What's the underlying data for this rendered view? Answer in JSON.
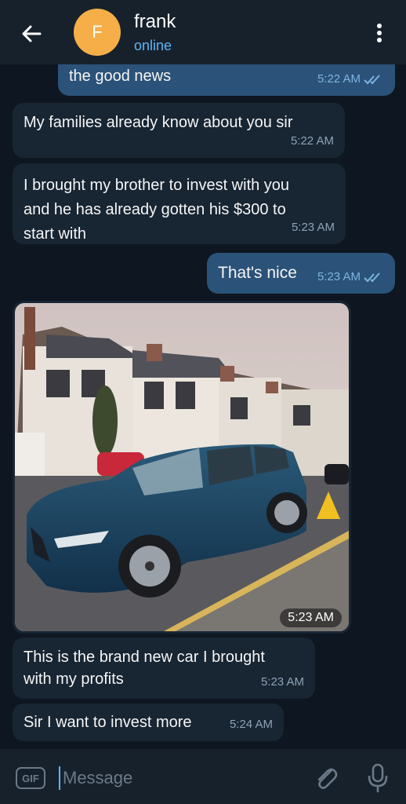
{
  "header": {
    "avatar_letter": "F",
    "contact_name": "frank",
    "status": "online",
    "avatar_color": "#f6ae48"
  },
  "messages": [
    {
      "direction": "out",
      "text": "the good news",
      "time": "5:22 AM",
      "read": true
    },
    {
      "direction": "in",
      "text": "My families already know about you sir",
      "time": "5:22 AM"
    },
    {
      "direction": "in",
      "text": "I brought my brother to invest with you\nand he has already gotten his $300 to\nstart with",
      "time": "5:23 AM"
    },
    {
      "direction": "out",
      "text": "That's nice",
      "time": "5:23 AM",
      "read": true
    },
    {
      "direction": "in",
      "type": "photo",
      "description": "blue car",
      "time": "5:23 AM"
    },
    {
      "direction": "in",
      "text": "This is the brand new car I brought\nwith my profits",
      "time": "5:23 AM"
    },
    {
      "direction": "in",
      "text": "Sir I want to invest more",
      "time": "5:24 AM"
    }
  ],
  "input": {
    "gif_label": "GIF",
    "placeholder": "Message"
  },
  "icons": {
    "back": "back-arrow-icon",
    "menu": "more-vertical-icon",
    "read": "double-check-icon",
    "attach": "paperclip-icon",
    "mic": "microphone-icon"
  },
  "colors": {
    "background": "#0e1621",
    "header": "#17212b",
    "incoming": "#182533",
    "outgoing": "#2b5278",
    "accent": "#5eb5f7"
  }
}
